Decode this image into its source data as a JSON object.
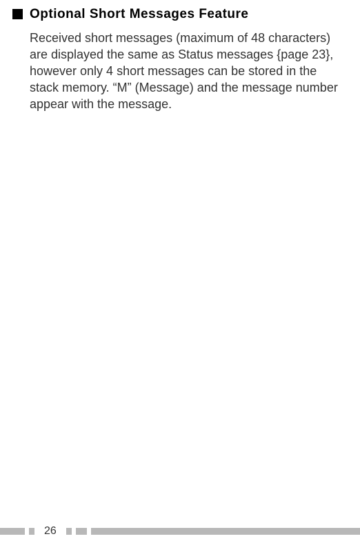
{
  "heading": "Optional Short Messages Feature",
  "body": "Received short messages (maximum of 48 characters) are displayed the same as Status messages {page 23}, however only 4 short messages can be stored in the stack memory.  “M” (Message) and the message number appear with the message.",
  "page_number": "26"
}
